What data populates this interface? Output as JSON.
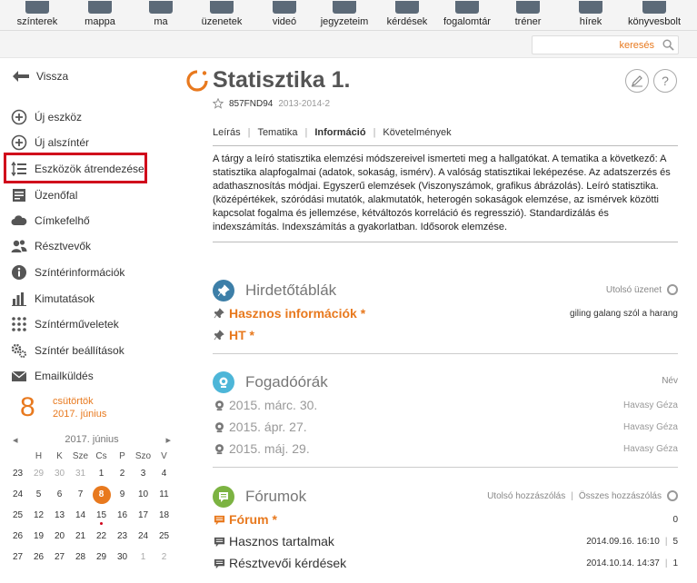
{
  "topnav": {
    "items": [
      "színterek",
      "mappa",
      "ma",
      "üzenetek",
      "videó",
      "jegyzeteim",
      "kérdések",
      "fogalomtár",
      "tréner",
      "hírek",
      "könyvesbolt"
    ]
  },
  "search": {
    "placeholder": "keresés"
  },
  "sidebar": {
    "back_label": "Vissza",
    "items": [
      {
        "label": "Új eszköz",
        "icon": "plus-circle-icon"
      },
      {
        "label": "Új alszíntér",
        "icon": "plus-circle-icon"
      },
      {
        "label": "Eszközök átrendezése",
        "icon": "reorder-icon"
      },
      {
        "label": "Üzenőfal",
        "icon": "board-icon"
      },
      {
        "label": "Címkefelhő",
        "icon": "cloud-icon"
      },
      {
        "label": "Résztvevők",
        "icon": "users-icon"
      },
      {
        "label": "Színtérinformációk",
        "icon": "info-icon"
      },
      {
        "label": "Kimutatások",
        "icon": "bar-chart-icon"
      },
      {
        "label": "Színtérműveletek",
        "icon": "grid-dots-icon"
      },
      {
        "label": "Színtér beállítások",
        "icon": "gears-icon"
      },
      {
        "label": "Emailküldés",
        "icon": "mail-icon"
      }
    ]
  },
  "date": {
    "day": "8",
    "weekday": "csütörtök",
    "month": "2017. június"
  },
  "calendar": {
    "title": "2017. június",
    "prev": "◂",
    "next": "▸",
    "dows": [
      "",
      "H",
      "K",
      "Sze",
      "Cs",
      "P",
      "Szo",
      "V"
    ],
    "weeks": [
      [
        "23",
        "29",
        "30",
        "31",
        "1",
        "2",
        "3",
        "4"
      ],
      [
        "24",
        "5",
        "6",
        "7",
        "8",
        "9",
        "10",
        "11"
      ],
      [
        "25",
        "12",
        "13",
        "14",
        "15",
        "16",
        "17",
        "18"
      ],
      [
        "26",
        "19",
        "20",
        "21",
        "22",
        "23",
        "24",
        "25"
      ],
      [
        "27",
        "26",
        "27",
        "28",
        "29",
        "30",
        "1",
        "2"
      ]
    ]
  },
  "course": {
    "title": "Statisztika 1.",
    "code": "857FND94",
    "term": "2013-2014-2",
    "tabs": [
      "Leírás",
      "Tematika",
      "Információ",
      "Követelmények"
    ],
    "description": "A tárgy a leíró statisztika elemzési módszereivel ismerteti meg a hallgatókat.  A tematika a következő: A statisztika alapfogalmai (adatok, sokaság, ismérv). A valóság statisztikai leképezése. Az adatszerzés és adathasznosítás módjai. Egyszerű elemzések (Viszonyszámok, grafikus ábrázolás). Leíró statisztika. (középértékek, szóródási mutatók, alakmutatók, heterogén sokaságok elemzése, az ismérvek közötti kapcsolat fogalma és jellemzése, kétváltozós korreláció és regresszió). Standardizálás és indexszámítás. Indexszámítás a gyakorlatban. Idősorok elemzése."
  },
  "boards": {
    "title": "Hirdetőtáblák",
    "right": "Utolsó üzenet",
    "rows": [
      {
        "label": "Hasznos információk *",
        "last": "giling galang szól a harang"
      },
      {
        "label": "HT *",
        "last": ""
      }
    ]
  },
  "office": {
    "title": "Fogadóórák",
    "right": "Név",
    "rows": [
      {
        "date": "2015. márc. 30.",
        "name": "Havasy Géza"
      },
      {
        "date": "2015. ápr. 27.",
        "name": "Havasy Géza"
      },
      {
        "date": "2015. máj. 29.",
        "name": "Havasy Géza"
      }
    ]
  },
  "forums": {
    "title": "Fórumok",
    "right1": "Utolsó hozzászólás",
    "right2": "Összes hozzászólás",
    "rows": [
      {
        "label": "Fórum *",
        "last": "",
        "count": "0"
      },
      {
        "label": "Hasznos tartalmak",
        "last": "2014.09.16. 16:10",
        "count": "5"
      },
      {
        "label": "Résztvevői kérdések",
        "last": "2014.10.14. 14:37",
        "count": "1"
      }
    ]
  },
  "colors": {
    "accent": "#e8791e",
    "highlight": "#d0021b",
    "board_icon": "#3d7fa8",
    "office_icon": "#4db6d8",
    "forum_icon": "#7cb342"
  }
}
